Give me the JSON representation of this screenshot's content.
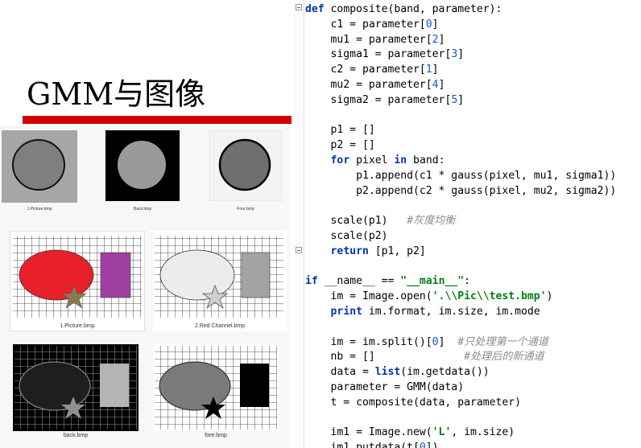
{
  "slide": {
    "title": "GMM与图像",
    "accent_color": "#d00000",
    "images": [
      {
        "caption": "1.Picture.bmp"
      },
      {
        "caption": "Back.bmp"
      },
      {
        "caption": "Fore.bmp"
      },
      {
        "caption": "1.Picture.bmp"
      },
      {
        "caption": "2.Red Channel.bmp"
      },
      {
        "caption": "back.bmp"
      },
      {
        "caption": "fore.bmp"
      }
    ]
  },
  "editor": {
    "lines": [
      [
        {
          "t": "def ",
          "c": "kw"
        },
        {
          "t": "composite(band, parameter):"
        }
      ],
      [
        {
          "t": "    c1 = parameter["
        },
        {
          "t": "0",
          "c": "num"
        },
        {
          "t": "]"
        }
      ],
      [
        {
          "t": "    mu1 = parameter["
        },
        {
          "t": "2",
          "c": "num"
        },
        {
          "t": "]"
        }
      ],
      [
        {
          "t": "    sigma1 = parameter["
        },
        {
          "t": "3",
          "c": "num"
        },
        {
          "t": "]"
        }
      ],
      [
        {
          "t": "    c2 = parameter["
        },
        {
          "t": "1",
          "c": "num"
        },
        {
          "t": "]"
        }
      ],
      [
        {
          "t": "    mu2 = parameter["
        },
        {
          "t": "4",
          "c": "num"
        },
        {
          "t": "]"
        }
      ],
      [
        {
          "t": "    sigma2 = parameter["
        },
        {
          "t": "5",
          "c": "num"
        },
        {
          "t": "]"
        }
      ],
      [],
      [
        {
          "t": "    p1 = []"
        }
      ],
      [
        {
          "t": "    p2 = []"
        }
      ],
      [
        {
          "t": "    "
        },
        {
          "t": "for",
          "c": "kw"
        },
        {
          "t": " pixel "
        },
        {
          "t": "in",
          "c": "kw"
        },
        {
          "t": " band:"
        }
      ],
      [
        {
          "t": "        p1.append(c1 * gauss(pixel, mu1, sigma1))"
        }
      ],
      [
        {
          "t": "        p2.append(c2 * gauss(pixel, mu2, sigma2))"
        }
      ],
      [],
      [
        {
          "t": "    scale(p1)   "
        },
        {
          "t": "#灰度均衡",
          "c": "com"
        }
      ],
      [
        {
          "t": "    scale(p2)"
        }
      ],
      [
        {
          "t": "    "
        },
        {
          "t": "return",
          "c": "kw"
        },
        {
          "t": " [p1, p2]"
        }
      ],
      [],
      [
        {
          "t": "if",
          "c": "kw"
        },
        {
          "t": " __name__ == "
        },
        {
          "t": "\"__main__\"",
          "c": "str"
        },
        {
          "t": ":"
        }
      ],
      [
        {
          "t": "    im = Image.open("
        },
        {
          "t": "'.\\\\Pic\\\\test.bmp'",
          "c": "str"
        },
        {
          "t": ")"
        }
      ],
      [
        {
          "t": "    "
        },
        {
          "t": "print",
          "c": "kw"
        },
        {
          "t": " im.format, im.size, im.mode"
        }
      ],
      [],
      [
        {
          "t": "    im = im.split()["
        },
        {
          "t": "0",
          "c": "num"
        },
        {
          "t": "]  "
        },
        {
          "t": "#只处理第一个通道",
          "c": "com"
        }
      ],
      [
        {
          "t": "    nb = []              "
        },
        {
          "t": "#处理后的新通道",
          "c": "com"
        }
      ],
      [
        {
          "t": "    data = "
        },
        {
          "t": "list",
          "c": "kw"
        },
        {
          "t": "(im.getdata())"
        }
      ],
      [
        {
          "t": "    parameter = GMM(data)"
        }
      ],
      [
        {
          "t": "    t = composite(data, parameter)"
        }
      ],
      [],
      [
        {
          "t": "    im1 = Image.new("
        },
        {
          "t": "'L'",
          "c": "str"
        },
        {
          "t": ", im.size)"
        }
      ],
      [
        {
          "t": "    im1.putdata(t["
        },
        {
          "t": "0",
          "c": "num"
        },
        {
          "t": "])"
        }
      ]
    ]
  }
}
